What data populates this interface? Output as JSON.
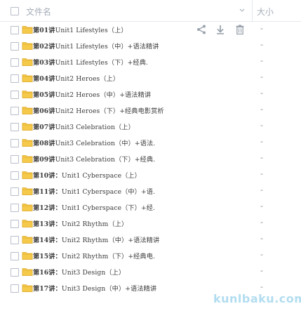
{
  "header": {
    "name_label": "文件名",
    "size_label": "大小"
  },
  "rows": [
    {
      "num": "第01讲",
      "text": "Unit1 Lifestyles（上）",
      "size": "-",
      "hover": true
    },
    {
      "num": "第02讲",
      "text": "Unit1 Lifestyles（中）+语法精讲",
      "size": "-"
    },
    {
      "num": "第03讲",
      "text": "Unit1 Lifestyles（下）+经典.",
      "size": "-"
    },
    {
      "num": "第04讲",
      "text": "Unit2 Heroes（上）",
      "size": "-"
    },
    {
      "num": "第05讲",
      "text": "Unit2 Heroes（中）+语法精讲",
      "size": "-"
    },
    {
      "num": "第06讲",
      "text": "Unit2 Heroes（下）+经典电影赏析",
      "size": "-"
    },
    {
      "num": "第07讲",
      "text": "Unit3 Celebration（上）",
      "size": "-"
    },
    {
      "num": "第08讲",
      "text": "Unit3 Celebration（中）+语法.",
      "size": "-"
    },
    {
      "num": "第09讲",
      "text": "Unit3 Celebration（下）+经典.",
      "size": "-"
    },
    {
      "num": "第10讲：",
      "text": "Unit1 Cyberspace（上）",
      "size": "-"
    },
    {
      "num": "第11讲：",
      "text": "Unit1 Cyberspace（中）+语.",
      "size": "-"
    },
    {
      "num": "第12讲：",
      "text": "Unit1 Cyberspace（下）+经.",
      "size": "-"
    },
    {
      "num": "第13讲：",
      "text": "Unit2 Rhythm（上）",
      "size": "-"
    },
    {
      "num": "第14讲：",
      "text": "Unit2 Rhythm（中）+语法精讲",
      "size": "-"
    },
    {
      "num": "第15讲：",
      "text": "Unit2 Rhythm（下）+经典电.",
      "size": "-"
    },
    {
      "num": "第16讲：",
      "text": "Unit3 Design（上）",
      "size": "-"
    },
    {
      "num": "第17讲：",
      "text": "Unit3 Design（中）+语法精讲",
      "size": "-"
    }
  ],
  "icons": {
    "folder": "folder-icon",
    "share": "share-icon",
    "download": "download-icon",
    "delete": "trash-icon",
    "sort": "chevron-down-icon"
  },
  "colors": {
    "folder_fill": "#f5c94a",
    "folder_edge": "#e0a92a",
    "action_icon": "#9aa3ad"
  },
  "watermark": "kunlbaku.com"
}
